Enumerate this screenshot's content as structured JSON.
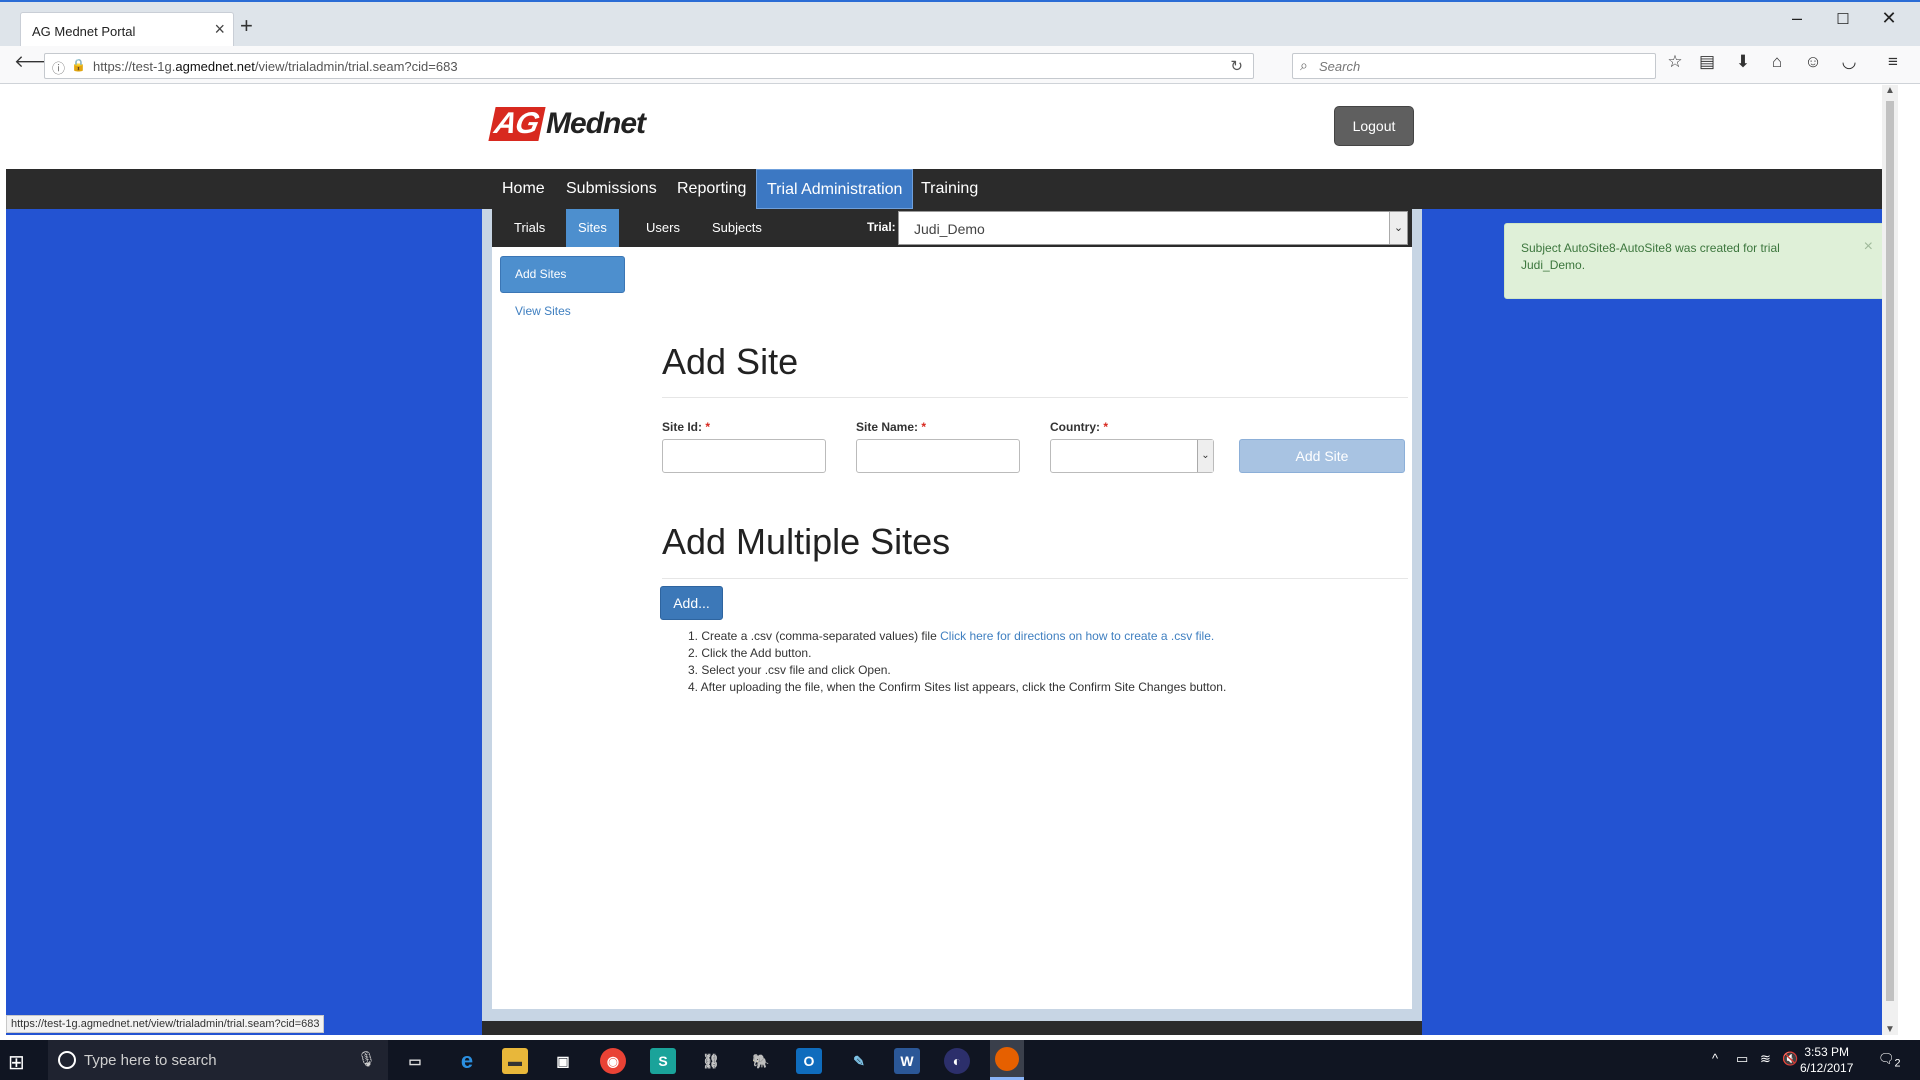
{
  "browser": {
    "tab_title": "AG Mednet Portal",
    "url_prefix": "https://test-1g.",
    "url_domain": "agmednet.net",
    "url_path": "/view/trialadmin/trial.seam?cid=683",
    "search_placeholder": "Search",
    "status_url": "https://test-1g.agmednet.net/view/trialadmin/trial.seam?cid=683"
  },
  "header": {
    "logo_ag": "AG",
    "logo_mednet": "Mednet",
    "logout_label": "Logout"
  },
  "menu": [
    "Home",
    "Submissions",
    "Reporting",
    "Trial Administration",
    "Training"
  ],
  "menu_active": "Trial Administration",
  "submenu": [
    "Trials",
    "Sites",
    "Users",
    "Subjects"
  ],
  "submenu_active": "Sites",
  "trial": {
    "label": "Trial:",
    "value": "Judi_Demo"
  },
  "side": {
    "add_sites": "Add Sites",
    "view_sites": "View Sites"
  },
  "add_site": {
    "heading": "Add Site",
    "site_id_label": "Site Id:",
    "site_name_label": "Site Name:",
    "country_label": "Country:",
    "required_mark": "*",
    "submit_label": "Add Site"
  },
  "add_multiple": {
    "heading": "Add Multiple Sites",
    "add_button": "Add...",
    "step1_prefix": "1. Create a .csv (comma-separated values) file ",
    "step1_link": "Click here for directions on how to create a .csv file.",
    "step2": "2. Click the Add button.",
    "step3": "3. Select your .csv file and click Open.",
    "step4": "4. After uploading the file, when the Confirm Sites list appears, click the Confirm Site Changes button."
  },
  "toast": {
    "message": "Subject AutoSite8-AutoSite8 was created for trial Judi_Demo."
  },
  "taskbar": {
    "search_placeholder": "Type here to search",
    "time": "3:53 PM",
    "date": "6/12/2017",
    "notif_count": "2"
  },
  "colors": {
    "page_bg": "#2353d2",
    "menu_bg": "#2b2b2b",
    "accent": "#4d8fce",
    "brand_red": "#d8291f",
    "toast_bg": "#dff0d8"
  }
}
